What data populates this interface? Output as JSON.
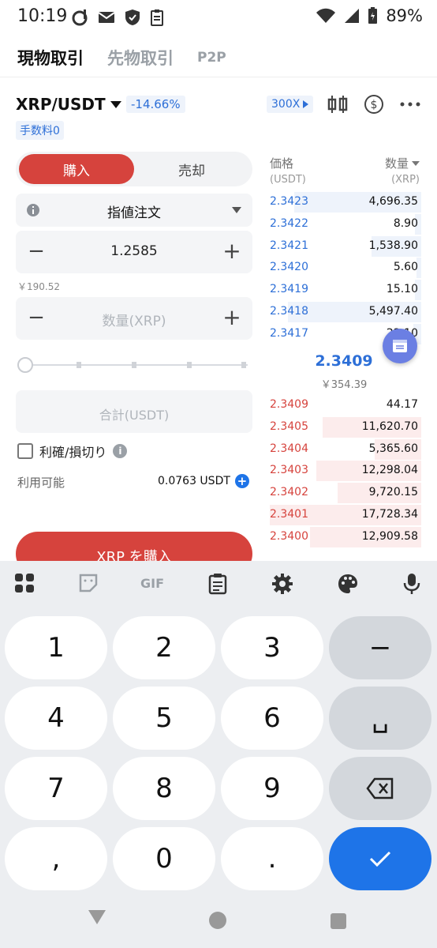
{
  "status_bar": {
    "time": "10:19",
    "battery": "89%"
  },
  "top_tabs": [
    {
      "label": "現物取引",
      "active": true
    },
    {
      "label": "先物取引",
      "active": false
    },
    {
      "label": "P2P",
      "active": false
    }
  ],
  "pair": {
    "name": "XRP/USDT",
    "change": "-14.66%",
    "leverage": "300X",
    "fee": "手数料0"
  },
  "trade_form": {
    "buy_tab": "購入",
    "sell_tab": "売却",
    "order_type": "指値注文",
    "price_value": "1.2585",
    "price_yen": "￥190.52",
    "quantity_placeholder": "数量(XRP)",
    "total_placeholder": "合計(USDT)",
    "tpsl_label": "利確/損切り",
    "available_label": "利用可能",
    "available_value": "0.0763 USDT",
    "buy_button": "XRP を購入"
  },
  "order_book": {
    "price_header": "価格",
    "price_unit": "(USDT)",
    "qty_header": "数量",
    "qty_unit": "(XRP)",
    "asks": [
      {
        "price": "2.3423",
        "qty": "4,696.35",
        "depth": 0.82
      },
      {
        "price": "2.3422",
        "qty": "8.90",
        "depth": 0.04
      },
      {
        "price": "2.3421",
        "qty": "1,538.90",
        "depth": 0.32
      },
      {
        "price": "2.3420",
        "qty": "5.60",
        "depth": 0.03
      },
      {
        "price": "2.3419",
        "qty": "15.10",
        "depth": 0.04
      },
      {
        "price": "2.3418",
        "qty": "5,497.40",
        "depth": 0.86
      },
      {
        "price": "2.3417",
        "qty": "22.10",
        "depth": 0.05
      }
    ],
    "last_price": "2.3409",
    "last_price_yen": "￥354.39",
    "bids": [
      {
        "price": "2.3409",
        "qty": "44.17",
        "depth": 0.0
      },
      {
        "price": "2.3405",
        "qty": "11,620.70",
        "depth": 0.64
      },
      {
        "price": "2.3404",
        "qty": "5,365.60",
        "depth": 0.3
      },
      {
        "price": "2.3403",
        "qty": "12,298.04",
        "depth": 0.68
      },
      {
        "price": "2.3402",
        "qty": "9,720.15",
        "depth": 0.54
      },
      {
        "price": "2.3401",
        "qty": "17,728.34",
        "depth": 0.98
      },
      {
        "price": "2.3400",
        "qty": "12,909.58",
        "depth": 0.72
      }
    ]
  },
  "keyboard": {
    "toolbar_icons": [
      "apps-icon",
      "sticker-icon",
      "gif-icon",
      "clipboard-icon",
      "settings-gear-icon",
      "palette-icon",
      "microphone-icon"
    ],
    "gif_label": "GIF",
    "keys": [
      "1",
      "2",
      "3",
      "−",
      "4",
      "5",
      "6",
      "␣",
      "7",
      "8",
      "9",
      "⌫",
      ",",
      "0",
      ".",
      "✓"
    ]
  }
}
